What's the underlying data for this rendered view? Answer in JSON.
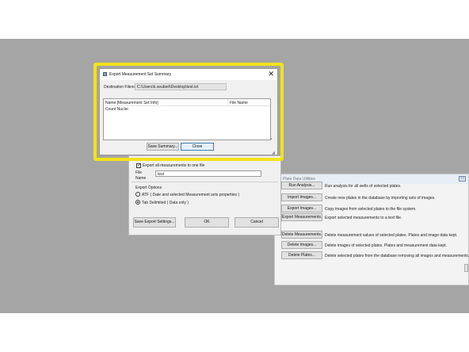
{
  "export_dialog": {
    "export_all_label": "Export all measurements to one file",
    "file_label": "File\nName",
    "file_value": "test",
    "export_options_label": "Export Options",
    "option_atf": "ATF ( Date and selected Measurement sets properties )",
    "option_tab": "Tab Delimited ( Data only )",
    "save_settings_button": "Save Export Settings...",
    "ok_button": "OK",
    "cancel_button": "Cancel"
  },
  "plate_utilities": {
    "title": "Plate Data Utilities",
    "rows": [
      {
        "button": "Run Analysis...",
        "desc": "Run analysis for all wells of selected plates."
      },
      {
        "button": "Import Images...",
        "desc": "Create new plates in the database by importing sets of images."
      },
      {
        "button": "Export Images...",
        "desc": "Copy images from selected plates to the file system."
      },
      {
        "button": "Export Measurements...",
        "desc": "Export selected measurements to a text file."
      },
      {
        "button": "Delete Measurements...",
        "desc": "Delete measurement values of selected plates. Plates and image data kept."
      },
      {
        "button": "Delete Images...",
        "desc": "Delete images of selected plates. Plates and measurement data kept."
      },
      {
        "button": "Delete Plates...",
        "desc": "Delete selected plates from the database removing all images and measurements."
      }
    ]
  },
  "summary_dialog": {
    "title": "Export Measurement Set Summary",
    "destination_label": "Destination Filename:",
    "destination_value": "C:\\Users\\k.seubert\\Desktop\\test.txt",
    "columns": [
      "Name [Measurement Set Info]",
      "File Name"
    ],
    "rows": [
      [
        "Count Nuclei",
        ""
      ]
    ],
    "save_summary_button": "Save Summary...",
    "close_button": "Close",
    "highlight_color": "#f2e21a"
  }
}
